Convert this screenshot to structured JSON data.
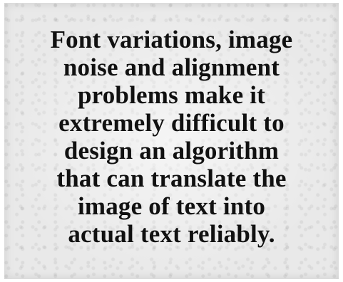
{
  "document": {
    "lines": [
      "Font variations, image",
      "noise and alignment",
      "problems make it",
      "extremely difficult to",
      "design an algorithm",
      "that can translate the",
      "image of text into",
      "actual text reliably."
    ]
  }
}
